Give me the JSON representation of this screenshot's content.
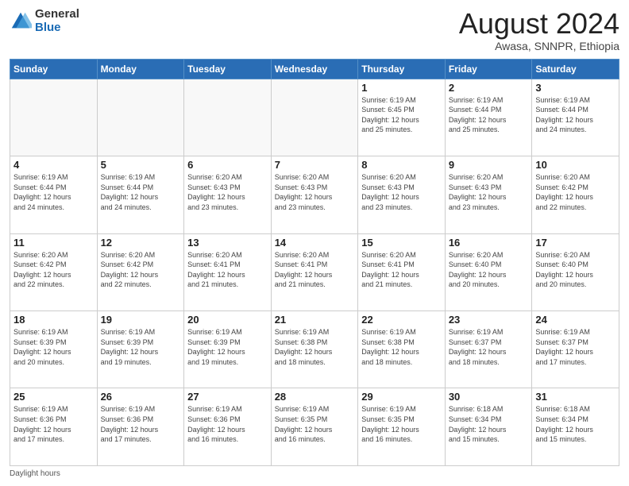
{
  "logo": {
    "general": "General",
    "blue": "Blue"
  },
  "header": {
    "month": "August 2024",
    "location": "Awasa, SNNPR, Ethiopia"
  },
  "days_of_week": [
    "Sunday",
    "Monday",
    "Tuesday",
    "Wednesday",
    "Thursday",
    "Friday",
    "Saturday"
  ],
  "footer": "Daylight hours",
  "weeks": [
    [
      {
        "day": "",
        "info": ""
      },
      {
        "day": "",
        "info": ""
      },
      {
        "day": "",
        "info": ""
      },
      {
        "day": "",
        "info": ""
      },
      {
        "day": "1",
        "info": "Sunrise: 6:19 AM\nSunset: 6:45 PM\nDaylight: 12 hours\nand 25 minutes."
      },
      {
        "day": "2",
        "info": "Sunrise: 6:19 AM\nSunset: 6:44 PM\nDaylight: 12 hours\nand 25 minutes."
      },
      {
        "day": "3",
        "info": "Sunrise: 6:19 AM\nSunset: 6:44 PM\nDaylight: 12 hours\nand 24 minutes."
      }
    ],
    [
      {
        "day": "4",
        "info": "Sunrise: 6:19 AM\nSunset: 6:44 PM\nDaylight: 12 hours\nand 24 minutes."
      },
      {
        "day": "5",
        "info": "Sunrise: 6:19 AM\nSunset: 6:44 PM\nDaylight: 12 hours\nand 24 minutes."
      },
      {
        "day": "6",
        "info": "Sunrise: 6:20 AM\nSunset: 6:43 PM\nDaylight: 12 hours\nand 23 minutes."
      },
      {
        "day": "7",
        "info": "Sunrise: 6:20 AM\nSunset: 6:43 PM\nDaylight: 12 hours\nand 23 minutes."
      },
      {
        "day": "8",
        "info": "Sunrise: 6:20 AM\nSunset: 6:43 PM\nDaylight: 12 hours\nand 23 minutes."
      },
      {
        "day": "9",
        "info": "Sunrise: 6:20 AM\nSunset: 6:43 PM\nDaylight: 12 hours\nand 23 minutes."
      },
      {
        "day": "10",
        "info": "Sunrise: 6:20 AM\nSunset: 6:42 PM\nDaylight: 12 hours\nand 22 minutes."
      }
    ],
    [
      {
        "day": "11",
        "info": "Sunrise: 6:20 AM\nSunset: 6:42 PM\nDaylight: 12 hours\nand 22 minutes."
      },
      {
        "day": "12",
        "info": "Sunrise: 6:20 AM\nSunset: 6:42 PM\nDaylight: 12 hours\nand 22 minutes."
      },
      {
        "day": "13",
        "info": "Sunrise: 6:20 AM\nSunset: 6:41 PM\nDaylight: 12 hours\nand 21 minutes."
      },
      {
        "day": "14",
        "info": "Sunrise: 6:20 AM\nSunset: 6:41 PM\nDaylight: 12 hours\nand 21 minutes."
      },
      {
        "day": "15",
        "info": "Sunrise: 6:20 AM\nSunset: 6:41 PM\nDaylight: 12 hours\nand 21 minutes."
      },
      {
        "day": "16",
        "info": "Sunrise: 6:20 AM\nSunset: 6:40 PM\nDaylight: 12 hours\nand 20 minutes."
      },
      {
        "day": "17",
        "info": "Sunrise: 6:20 AM\nSunset: 6:40 PM\nDaylight: 12 hours\nand 20 minutes."
      }
    ],
    [
      {
        "day": "18",
        "info": "Sunrise: 6:19 AM\nSunset: 6:39 PM\nDaylight: 12 hours\nand 20 minutes."
      },
      {
        "day": "19",
        "info": "Sunrise: 6:19 AM\nSunset: 6:39 PM\nDaylight: 12 hours\nand 19 minutes."
      },
      {
        "day": "20",
        "info": "Sunrise: 6:19 AM\nSunset: 6:39 PM\nDaylight: 12 hours\nand 19 minutes."
      },
      {
        "day": "21",
        "info": "Sunrise: 6:19 AM\nSunset: 6:38 PM\nDaylight: 12 hours\nand 18 minutes."
      },
      {
        "day": "22",
        "info": "Sunrise: 6:19 AM\nSunset: 6:38 PM\nDaylight: 12 hours\nand 18 minutes."
      },
      {
        "day": "23",
        "info": "Sunrise: 6:19 AM\nSunset: 6:37 PM\nDaylight: 12 hours\nand 18 minutes."
      },
      {
        "day": "24",
        "info": "Sunrise: 6:19 AM\nSunset: 6:37 PM\nDaylight: 12 hours\nand 17 minutes."
      }
    ],
    [
      {
        "day": "25",
        "info": "Sunrise: 6:19 AM\nSunset: 6:36 PM\nDaylight: 12 hours\nand 17 minutes."
      },
      {
        "day": "26",
        "info": "Sunrise: 6:19 AM\nSunset: 6:36 PM\nDaylight: 12 hours\nand 17 minutes."
      },
      {
        "day": "27",
        "info": "Sunrise: 6:19 AM\nSunset: 6:36 PM\nDaylight: 12 hours\nand 16 minutes."
      },
      {
        "day": "28",
        "info": "Sunrise: 6:19 AM\nSunset: 6:35 PM\nDaylight: 12 hours\nand 16 minutes."
      },
      {
        "day": "29",
        "info": "Sunrise: 6:19 AM\nSunset: 6:35 PM\nDaylight: 12 hours\nand 16 minutes."
      },
      {
        "day": "30",
        "info": "Sunrise: 6:18 AM\nSunset: 6:34 PM\nDaylight: 12 hours\nand 15 minutes."
      },
      {
        "day": "31",
        "info": "Sunrise: 6:18 AM\nSunset: 6:34 PM\nDaylight: 12 hours\nand 15 minutes."
      }
    ]
  ]
}
